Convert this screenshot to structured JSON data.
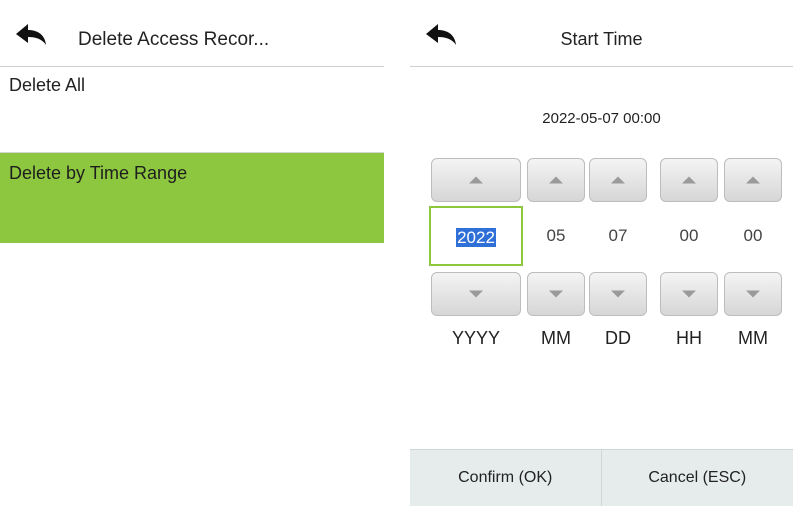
{
  "left_panel": {
    "title": "Delete Access Recor...",
    "back_icon": "back-arrow-icon",
    "items": [
      {
        "label": "Delete All",
        "selected": false
      },
      {
        "label": "Delete by Time Range",
        "selected": true
      }
    ]
  },
  "right_panel": {
    "title": "Start Time",
    "back_icon": "back-arrow-icon",
    "current_value": "2022-05-07 00:00",
    "spinners": [
      {
        "value": "2022",
        "label": "YYYY",
        "active": true
      },
      {
        "value": "05",
        "label": "MM",
        "active": false
      },
      {
        "value": "07",
        "label": "DD",
        "active": false
      },
      {
        "value": "00",
        "label": "HH",
        "active": false
      },
      {
        "value": "00",
        "label": "MM",
        "active": false
      }
    ],
    "confirm_label": "Confirm (OK)",
    "cancel_label": "Cancel (ESC)"
  },
  "colors": {
    "accent_green": "#8dc63f",
    "selection_blue": "#2f6fd8",
    "footer_bg": "#e6ecec"
  }
}
